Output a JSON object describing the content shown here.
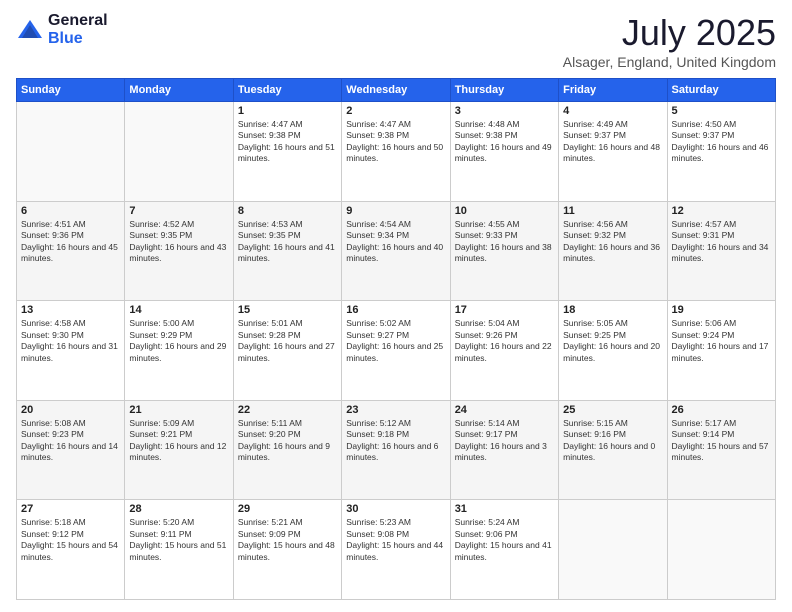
{
  "logo": {
    "general": "General",
    "blue": "Blue"
  },
  "title": "July 2025",
  "subtitle": "Alsager, England, United Kingdom",
  "days_of_week": [
    "Sunday",
    "Monday",
    "Tuesday",
    "Wednesday",
    "Thursday",
    "Friday",
    "Saturday"
  ],
  "weeks": [
    [
      {
        "day": "",
        "info": ""
      },
      {
        "day": "",
        "info": ""
      },
      {
        "day": "1",
        "info": "Sunrise: 4:47 AM\nSunset: 9:38 PM\nDaylight: 16 hours and 51 minutes."
      },
      {
        "day": "2",
        "info": "Sunrise: 4:47 AM\nSunset: 9:38 PM\nDaylight: 16 hours and 50 minutes."
      },
      {
        "day": "3",
        "info": "Sunrise: 4:48 AM\nSunset: 9:38 PM\nDaylight: 16 hours and 49 minutes."
      },
      {
        "day": "4",
        "info": "Sunrise: 4:49 AM\nSunset: 9:37 PM\nDaylight: 16 hours and 48 minutes."
      },
      {
        "day": "5",
        "info": "Sunrise: 4:50 AM\nSunset: 9:37 PM\nDaylight: 16 hours and 46 minutes."
      }
    ],
    [
      {
        "day": "6",
        "info": "Sunrise: 4:51 AM\nSunset: 9:36 PM\nDaylight: 16 hours and 45 minutes."
      },
      {
        "day": "7",
        "info": "Sunrise: 4:52 AM\nSunset: 9:35 PM\nDaylight: 16 hours and 43 minutes."
      },
      {
        "day": "8",
        "info": "Sunrise: 4:53 AM\nSunset: 9:35 PM\nDaylight: 16 hours and 41 minutes."
      },
      {
        "day": "9",
        "info": "Sunrise: 4:54 AM\nSunset: 9:34 PM\nDaylight: 16 hours and 40 minutes."
      },
      {
        "day": "10",
        "info": "Sunrise: 4:55 AM\nSunset: 9:33 PM\nDaylight: 16 hours and 38 minutes."
      },
      {
        "day": "11",
        "info": "Sunrise: 4:56 AM\nSunset: 9:32 PM\nDaylight: 16 hours and 36 minutes."
      },
      {
        "day": "12",
        "info": "Sunrise: 4:57 AM\nSunset: 9:31 PM\nDaylight: 16 hours and 34 minutes."
      }
    ],
    [
      {
        "day": "13",
        "info": "Sunrise: 4:58 AM\nSunset: 9:30 PM\nDaylight: 16 hours and 31 minutes."
      },
      {
        "day": "14",
        "info": "Sunrise: 5:00 AM\nSunset: 9:29 PM\nDaylight: 16 hours and 29 minutes."
      },
      {
        "day": "15",
        "info": "Sunrise: 5:01 AM\nSunset: 9:28 PM\nDaylight: 16 hours and 27 minutes."
      },
      {
        "day": "16",
        "info": "Sunrise: 5:02 AM\nSunset: 9:27 PM\nDaylight: 16 hours and 25 minutes."
      },
      {
        "day": "17",
        "info": "Sunrise: 5:04 AM\nSunset: 9:26 PM\nDaylight: 16 hours and 22 minutes."
      },
      {
        "day": "18",
        "info": "Sunrise: 5:05 AM\nSunset: 9:25 PM\nDaylight: 16 hours and 20 minutes."
      },
      {
        "day": "19",
        "info": "Sunrise: 5:06 AM\nSunset: 9:24 PM\nDaylight: 16 hours and 17 minutes."
      }
    ],
    [
      {
        "day": "20",
        "info": "Sunrise: 5:08 AM\nSunset: 9:23 PM\nDaylight: 16 hours and 14 minutes."
      },
      {
        "day": "21",
        "info": "Sunrise: 5:09 AM\nSunset: 9:21 PM\nDaylight: 16 hours and 12 minutes."
      },
      {
        "day": "22",
        "info": "Sunrise: 5:11 AM\nSunset: 9:20 PM\nDaylight: 16 hours and 9 minutes."
      },
      {
        "day": "23",
        "info": "Sunrise: 5:12 AM\nSunset: 9:18 PM\nDaylight: 16 hours and 6 minutes."
      },
      {
        "day": "24",
        "info": "Sunrise: 5:14 AM\nSunset: 9:17 PM\nDaylight: 16 hours and 3 minutes."
      },
      {
        "day": "25",
        "info": "Sunrise: 5:15 AM\nSunset: 9:16 PM\nDaylight: 16 hours and 0 minutes."
      },
      {
        "day": "26",
        "info": "Sunrise: 5:17 AM\nSunset: 9:14 PM\nDaylight: 15 hours and 57 minutes."
      }
    ],
    [
      {
        "day": "27",
        "info": "Sunrise: 5:18 AM\nSunset: 9:12 PM\nDaylight: 15 hours and 54 minutes."
      },
      {
        "day": "28",
        "info": "Sunrise: 5:20 AM\nSunset: 9:11 PM\nDaylight: 15 hours and 51 minutes."
      },
      {
        "day": "29",
        "info": "Sunrise: 5:21 AM\nSunset: 9:09 PM\nDaylight: 15 hours and 48 minutes."
      },
      {
        "day": "30",
        "info": "Sunrise: 5:23 AM\nSunset: 9:08 PM\nDaylight: 15 hours and 44 minutes."
      },
      {
        "day": "31",
        "info": "Sunrise: 5:24 AM\nSunset: 9:06 PM\nDaylight: 15 hours and 41 minutes."
      },
      {
        "day": "",
        "info": ""
      },
      {
        "day": "",
        "info": ""
      }
    ]
  ]
}
